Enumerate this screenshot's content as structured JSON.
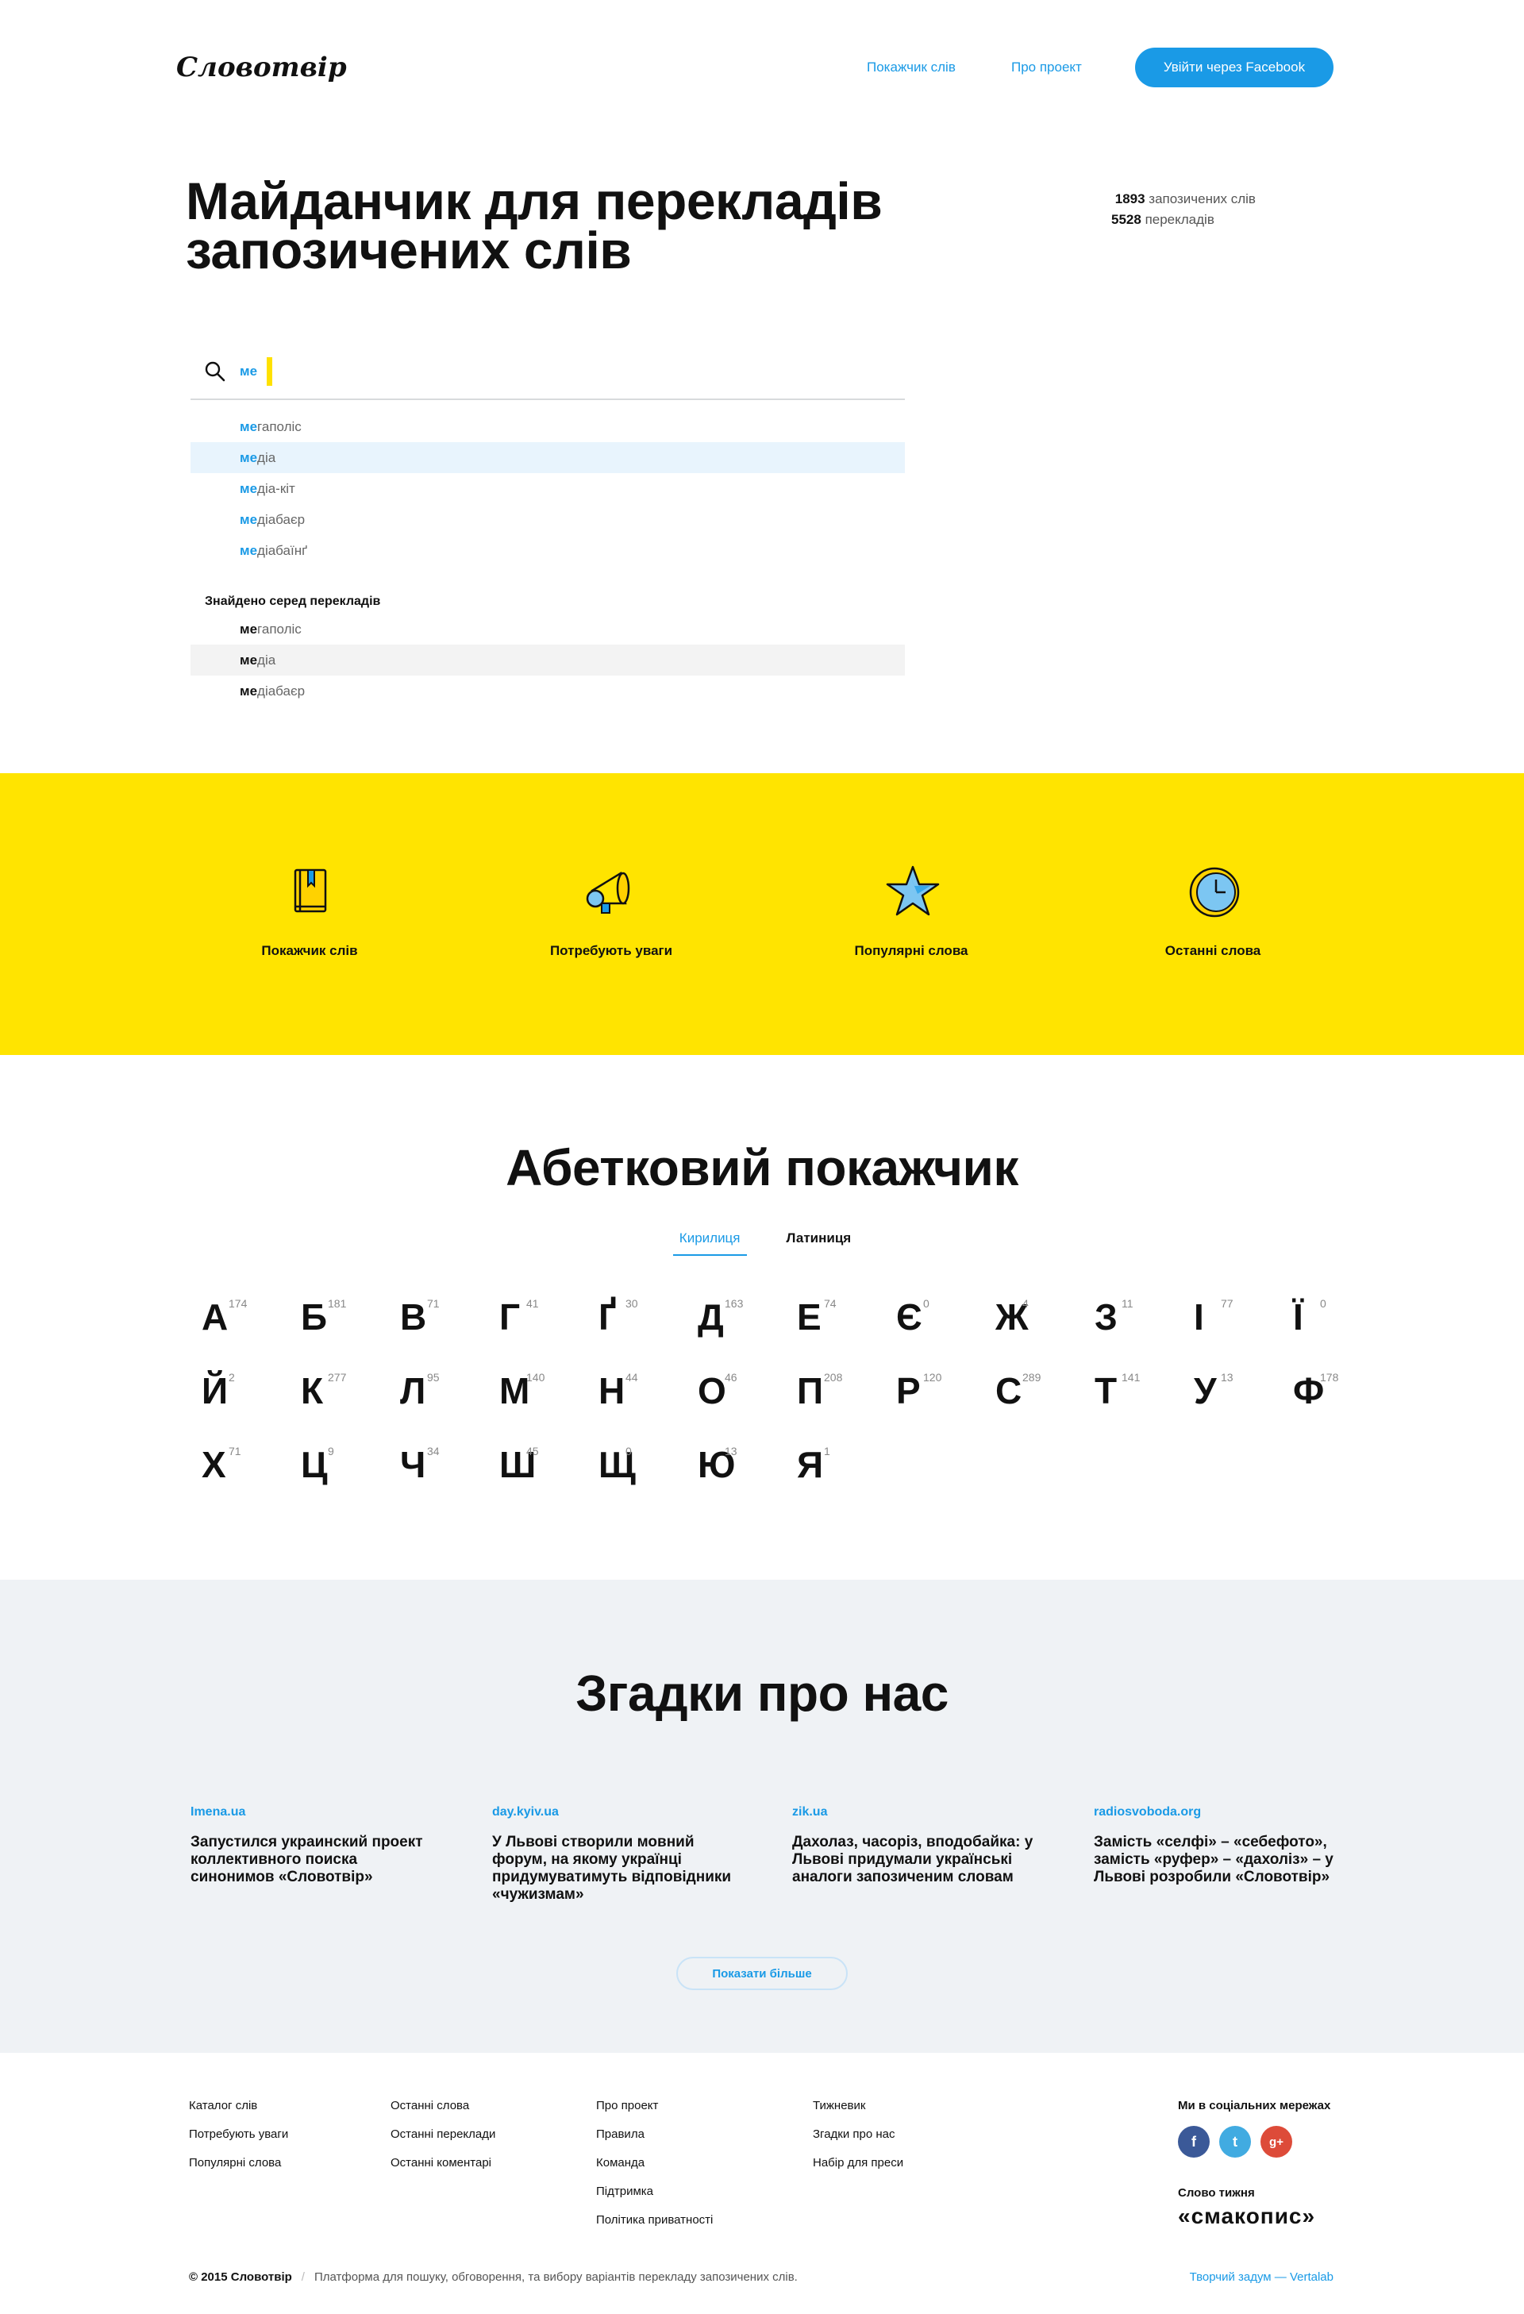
{
  "brand": {
    "name": "Словотвір"
  },
  "nav": {
    "items": [
      {
        "label": "Покажчик слів"
      },
      {
        "label": "Про проект"
      }
    ],
    "login_label": "Увійти через Facebook"
  },
  "hero": {
    "title_line1": "Майданчик для перекладів",
    "title_line2": "запозичених слів",
    "stats": {
      "borrowed_count": "1893",
      "borrowed_label": "запозичених слів",
      "translations_count": "5528",
      "translations_label": "перекладів"
    }
  },
  "search": {
    "typed": "ме",
    "suggestions": [
      {
        "prefix": "ме",
        "rest": "гаполіс"
      },
      {
        "prefix": "ме",
        "rest": "діа"
      },
      {
        "prefix": "ме",
        "rest": "діа-кіт"
      },
      {
        "prefix": "ме",
        "rest": "діабаєр"
      },
      {
        "prefix": "ме",
        "rest": "діабаїнґ"
      }
    ],
    "translations_label": "Знайдено серед перекладів",
    "translations": [
      {
        "prefix": "ме",
        "rest": "гаполіс"
      },
      {
        "prefix": "ме",
        "rest": "діа"
      },
      {
        "prefix": "ме",
        "rest": "діабаєр"
      }
    ]
  },
  "features": [
    {
      "label": "Покажчик слів",
      "icon": "book-icon"
    },
    {
      "label": "Потребують уваги",
      "icon": "megaphone-icon"
    },
    {
      "label": "Популярні слова",
      "icon": "star-icon"
    },
    {
      "label": "Останні слова",
      "icon": "clock-icon"
    }
  ],
  "alphabet": {
    "title": "Абетковий покажчик",
    "tabs": [
      {
        "label": "Кирилиця"
      },
      {
        "label": "Латиниця"
      }
    ],
    "letters": [
      {
        "ch": "А",
        "n": "174"
      },
      {
        "ch": "Б",
        "n": "181"
      },
      {
        "ch": "В",
        "n": "71"
      },
      {
        "ch": "Г",
        "n": "41"
      },
      {
        "ch": "Ґ",
        "n": "30"
      },
      {
        "ch": "Д",
        "n": "163"
      },
      {
        "ch": "Е",
        "n": "74"
      },
      {
        "ch": "Є",
        "n": "0"
      },
      {
        "ch": "Ж",
        "n": "4"
      },
      {
        "ch": "З",
        "n": "11"
      },
      {
        "ch": "І",
        "n": "77"
      },
      {
        "ch": "Ї",
        "n": "0"
      },
      {
        "ch": "Й",
        "n": "2"
      },
      {
        "ch": "К",
        "n": "277"
      },
      {
        "ch": "Л",
        "n": "95"
      },
      {
        "ch": "М",
        "n": "140"
      },
      {
        "ch": "Н",
        "n": "44"
      },
      {
        "ch": "О",
        "n": "46"
      },
      {
        "ch": "П",
        "n": "208"
      },
      {
        "ch": "Р",
        "n": "120"
      },
      {
        "ch": "С",
        "n": "289"
      },
      {
        "ch": "Т",
        "n": "141"
      },
      {
        "ch": "У",
        "n": "13"
      },
      {
        "ch": "Ф",
        "n": "178"
      },
      {
        "ch": "Х",
        "n": "71"
      },
      {
        "ch": "Ц",
        "n": "9"
      },
      {
        "ch": "Ч",
        "n": "34"
      },
      {
        "ch": "Ш",
        "n": "45"
      },
      {
        "ch": "Щ",
        "n": "0"
      },
      {
        "ch": "Ю",
        "n": "13"
      },
      {
        "ch": "Я",
        "n": "1"
      }
    ]
  },
  "mentions": {
    "title": "Згадки про нас",
    "items": [
      {
        "source": "Imena.ua",
        "title": "Запустился украинский проект коллективного поиска синонимов «Словотвір»"
      },
      {
        "source": "day.kyiv.ua",
        "title": "У Львові створили мовний форум, на якому українці придумуватимуть відповідники «чужизмам»"
      },
      {
        "source": "zik.ua",
        "title": "Дахолаз, часоріз, вподобайка: у Львові придумали українські аналоги запозиченим словам"
      },
      {
        "source": "radiosvoboda.org",
        "title": "Замість «селфі» – «себефото», замість «руфер» – «дахоліз» – у Львові розробили «Словотвір»"
      }
    ],
    "more_label": "Показати більше"
  },
  "footer": {
    "col1": [
      "Каталог слів",
      "Потребують уваги",
      "Популярні слова"
    ],
    "col2": [
      "Останні слова",
      "Останні переклади",
      "Останні коментарі"
    ],
    "col3": [
      "Про проект",
      "Правила",
      "Команда",
      "Підтримка",
      "Політика приватності"
    ],
    "col4": [
      "Тижневик",
      "Згадки про нас",
      "Набір для преси"
    ],
    "social_title": "Ми в соціальних мережах",
    "social": [
      {
        "glyph": "f",
        "icon": "facebook-icon",
        "color": "#3b5998"
      },
      {
        "glyph": "t",
        "icon": "twitter-icon",
        "color": "#41abe1"
      },
      {
        "glyph": "g+",
        "icon": "googleplus-icon",
        "color": "#dd4b39"
      }
    ],
    "word_of_week_label": "Слово тижня",
    "word_of_week": "«смакопис»",
    "copyright": "© 2015 Словотвір",
    "sep": "/",
    "tagline": "Платформа для пошуку, обговорення, та вибору варіантів перекладу запозичених слів.",
    "credit": "Творчий задум — Vertalab"
  },
  "colors": {
    "accent": "#1a9ae6",
    "yellow": "#ffe400",
    "mentions_bg": "#eff2f5"
  }
}
